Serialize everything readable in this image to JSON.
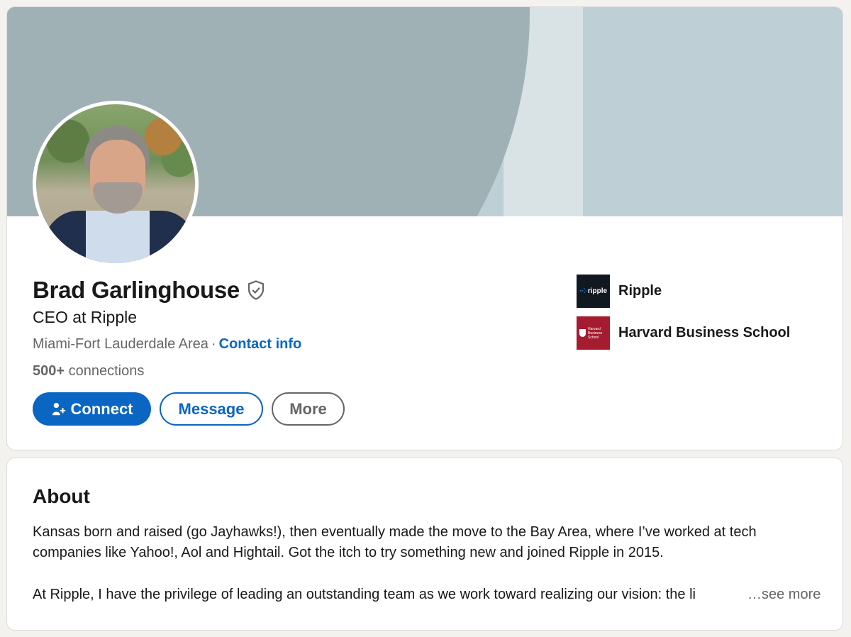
{
  "profile": {
    "name": "Brad Garlinghouse",
    "headline": "CEO at Ripple",
    "location": "Miami-Fort Lauderdale Area",
    "separator": "·",
    "contact_info_label": "Contact info",
    "connections_count": "500+",
    "connections_label": "connections",
    "verified_icon": "shield-check-icon",
    "avatar_alt": "profile photo"
  },
  "actions": {
    "connect_label": "Connect",
    "message_label": "Message",
    "more_label": "More"
  },
  "side": {
    "items": [
      {
        "label": "Ripple",
        "logo_text": "ripple",
        "logo_color": "#111820"
      },
      {
        "label": "Harvard Business School",
        "logo_text": "Harvard Business School",
        "logo_color": "#a51c30"
      }
    ]
  },
  "about": {
    "title": "About",
    "paragraph1": "Kansas born and raised (go Jayhawks!), then eventually made the move to the Bay Area, where I’ve worked at tech companies like Yahoo!, Aol and Hightail. Got the itch to try something new and joined Ripple in 2015.",
    "paragraph2": "At Ripple, I have the privilege of leading an outstanding team as we work toward realizing our vision: the li",
    "see_more": "…see more"
  },
  "colors": {
    "accent": "#0a66c2",
    "banner": "#becfd6",
    "banner_arc": "#a0b1b6"
  }
}
